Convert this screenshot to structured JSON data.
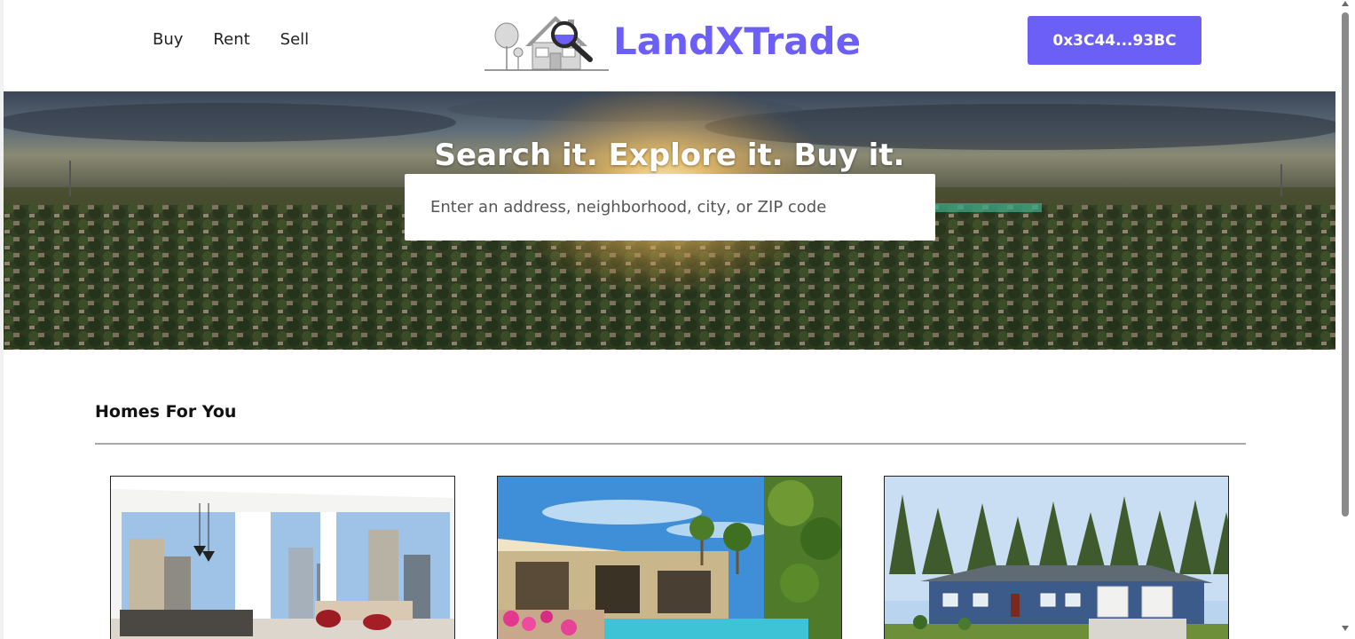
{
  "nav": {
    "buy": "Buy",
    "rent": "Rent",
    "sell": "Sell"
  },
  "brand": {
    "name": "LandXTrade",
    "color": "#6c5ff5"
  },
  "wallet": {
    "label": "0x3C44...93BC"
  },
  "hero": {
    "title": "Search it. Explore it. Buy it.",
    "search_placeholder": "Enter an address, neighborhood, city, or ZIP code"
  },
  "homes": {
    "title": "Homes For You",
    "cards": [
      {
        "scene": "modern-apartment-interior"
      },
      {
        "scene": "house-with-pool-and-palms"
      },
      {
        "scene": "blue-ranch-house-in-forest"
      }
    ]
  },
  "icons": [
    "house-magnifier-logo-icon",
    "scroll-up-arrow-icon",
    "scroll-down-arrow-icon"
  ]
}
